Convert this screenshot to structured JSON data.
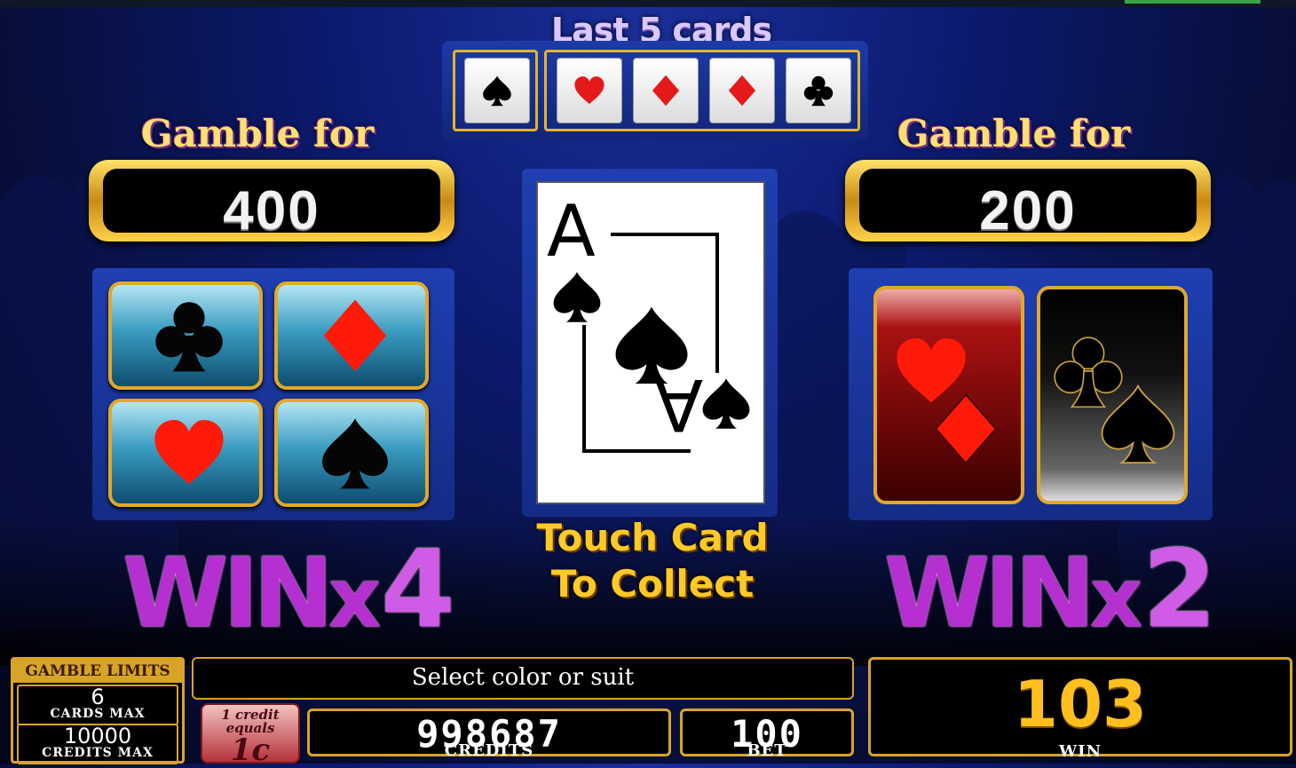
{
  "history": {
    "title": "Last 5 cards",
    "cards": [
      {
        "suit": "spade",
        "color": "#000000"
      },
      {
        "suit": "heart",
        "color": "#e41a1a"
      },
      {
        "suit": "diamond",
        "color": "#e41a1a"
      },
      {
        "suit": "diamond",
        "color": "#e41a1a"
      },
      {
        "suit": "club",
        "color": "#000000"
      }
    ]
  },
  "suit_gamble": {
    "title": "Gamble for",
    "amount": "400",
    "options": [
      "club",
      "diamond",
      "heart",
      "spade"
    ],
    "multiplier_word": "WIN",
    "multiplier_x": "x",
    "multiplier_n": "4"
  },
  "color_gamble": {
    "title": "Gamble for",
    "amount": "200",
    "options": [
      "red",
      "black"
    ],
    "multiplier_word": "WIN",
    "multiplier_x": "x",
    "multiplier_n": "2"
  },
  "current_card": {
    "rank": "A",
    "suit": "spade"
  },
  "prompt": {
    "line1": "Touch Card",
    "line2": "To Collect"
  },
  "status_message": "Select color or suit",
  "limits": {
    "title": "GAMBLE LIMITS",
    "cards_value": "6",
    "cards_label": "CARDS MAX",
    "credits_value": "10000",
    "credits_label": "CREDITS MAX"
  },
  "denomination": {
    "line1": "1 credit",
    "line2": "equals",
    "value": "1c"
  },
  "meters": {
    "credits_value": "998687",
    "credits_label": "CREDITS",
    "bet_value": "100",
    "bet_label": "BET",
    "win_value": "103",
    "win_label": "WIN"
  },
  "colors": {
    "accent_gold": "#d8a428",
    "red_suit": "#e41a1a",
    "win_purple": "#b62fd0"
  }
}
